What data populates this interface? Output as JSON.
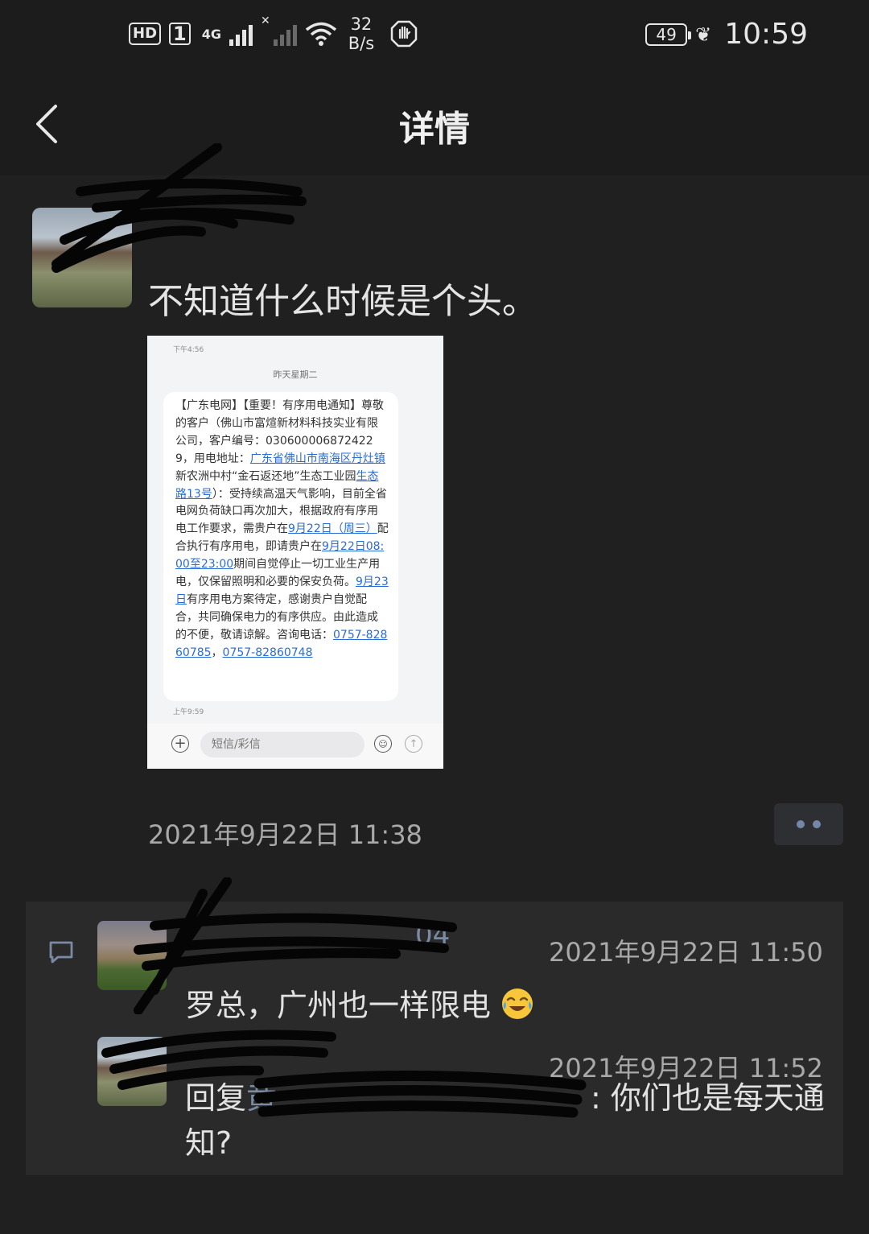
{
  "status_bar": {
    "hd": "HD",
    "sim": "1",
    "net_type": "4G",
    "net_speed_value": "32",
    "net_speed_unit": "B/s",
    "battery": "49",
    "time": "10:59"
  },
  "header": {
    "title": "详情"
  },
  "post": {
    "text": "不知道什么时候是个头。",
    "timestamp": "2021年9月22日 11:38",
    "image": {
      "top_time": "下午4:56",
      "date_label": "昨天星期二",
      "sms_parts": [
        "【广东电网】【重要！有序用电通知】尊敬的客户（佛山市富煊新材料科技实业有限公司，客户编号：0306000068724229，用电地址：",
        "广东省佛山市南海区丹灶镇",
        "新农洲中村“金石返还地”生态工业园",
        "生态路13号",
        "）：受持续高温天气影响，目前全省电网负荷缺口再次加大，根据政府有序用电工作要求，需贵户在",
        "9月22日（周三）",
        "配合执行有序用电，即请贵户在",
        "9月22日08:00至23:00",
        "期间自觉停止一切工业生产用电，仅保留照明和必要的保安负荷。",
        "9月23日",
        "有序用电方案待定，感谢贵户自觉配合，共同确保电力的有序供应。由此造成的不便，敬请谅解。咨询电话：",
        "0757-82860785",
        "，",
        "0757-82860748"
      ],
      "bottom_time": "上午9:59",
      "input_placeholder": "短信/彩信"
    }
  },
  "comments": [
    {
      "name_fragment": "04",
      "timestamp": "2021年9月22日 11:50",
      "text": "罗总，广州也一样限电"
    },
    {
      "timestamp": "2021年9月22日 11:52",
      "reply_prefix": "回复",
      "reply_visible_char": "黄",
      "reply_tail": ": 你们也是每天通知?"
    }
  ],
  "colors": {
    "background": "#202020",
    "comment_panel": "#2a2a2a",
    "link": "#2a6cd6",
    "name_blue": "#7b8ba3"
  },
  "icons": [
    "back-chevron-icon",
    "wifi-icon",
    "hexagon-hand-icon",
    "battery-icon",
    "leaf-icon",
    "comment-icon",
    "more-dots-icon",
    "add-icon",
    "emoji-icon",
    "send-icon"
  ]
}
